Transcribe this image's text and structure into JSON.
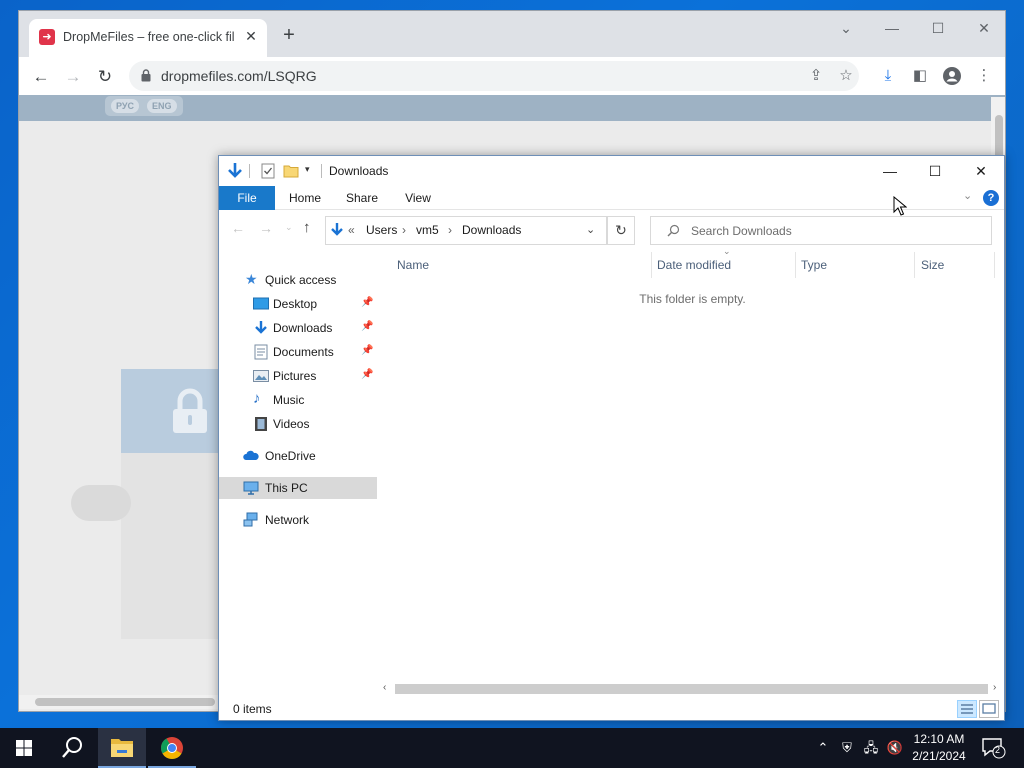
{
  "browser": {
    "tab_title": "DropMeFiles – free one-click file",
    "tab_favicon": "➜",
    "url": "dropmefiles.com/LSQRG",
    "lang_ru": "РУС",
    "lang_en": "ENG"
  },
  "explorer": {
    "title": "Downloads",
    "ribbon": {
      "file": "File",
      "home": "Home",
      "share": "Share",
      "view": "View"
    },
    "breadcrumb": {
      "overflow": "«",
      "items": [
        "Users",
        "vm5",
        "Downloads"
      ]
    },
    "search_placeholder": "Search Downloads",
    "nav": {
      "quick_access": "Quick access",
      "desktop": "Desktop",
      "downloads": "Downloads",
      "documents": "Documents",
      "pictures": "Pictures",
      "music": "Music",
      "videos": "Videos",
      "onedrive": "OneDrive",
      "this_pc": "This PC",
      "network": "Network"
    },
    "columns": {
      "name": "Name",
      "date_modified": "Date modified",
      "type": "Type",
      "size": "Size"
    },
    "empty_message": "This folder is empty.",
    "status": "0 items"
  },
  "taskbar": {
    "time": "12:10 AM",
    "date": "2/21/2024",
    "notification_count": "2"
  },
  "colors": {
    "accent": "#1979ca",
    "desktop": "#0b6ad0",
    "taskbar": "#101420"
  }
}
